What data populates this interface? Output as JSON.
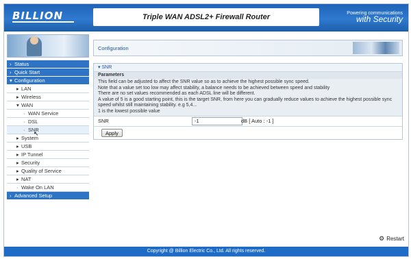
{
  "header": {
    "logo": "BILLION",
    "banner": "Triple WAN ADSL2+ Firewall Router",
    "slogan_line1": "Powering communications",
    "slogan_line2": "with Security"
  },
  "sidebar": {
    "items": [
      {
        "label": "Status",
        "level": 0
      },
      {
        "label": "Quick Start",
        "level": 0
      },
      {
        "label": "Configuration",
        "level": 0
      },
      {
        "label": "LAN",
        "level": 1
      },
      {
        "label": "Wireless",
        "level": 1
      },
      {
        "label": "WAN",
        "level": 1
      },
      {
        "label": "WAN Service",
        "level": 2
      },
      {
        "label": "DSL",
        "level": 2
      },
      {
        "label": "SNR",
        "level": 2
      },
      {
        "label": "System",
        "level": 1
      },
      {
        "label": "USB",
        "level": 1
      },
      {
        "label": "IP Tunnel",
        "level": 1
      },
      {
        "label": "Security",
        "level": 1
      },
      {
        "label": "Quality of Service",
        "level": 1
      },
      {
        "label": "NAT",
        "level": 1
      },
      {
        "label": "Wake On LAN",
        "level": 1
      },
      {
        "label": "Advanced Setup",
        "level": 0
      }
    ]
  },
  "content": {
    "section_title": "Configuration",
    "panel_title": "SNR",
    "params_heading": "Parameters",
    "description": [
      "This field can be adjusted to affect the SNR value so as to achieve the highest possible sync speed.",
      "Note that a value set too low may affect stability, a balance needs to be achieved between speed and stability",
      "There are no set values recommended as each ADSL line will be different.",
      "A value of 5 is a good starting point, this is the target SNR, from here you can gradually reduce values to achieve the highest possible sync speed whilst still maintaining stability. e.g 5,4...",
      "1 is the lowest possible value"
    ],
    "snr_label": "SNR",
    "snr_value": "-1",
    "snr_unit": "dB [ Auto : -1 ]",
    "apply_label": "Apply"
  },
  "restart_label": "Restart",
  "footer": "Copyright @ Billion Electric Co., Ltd. All rights reserved."
}
